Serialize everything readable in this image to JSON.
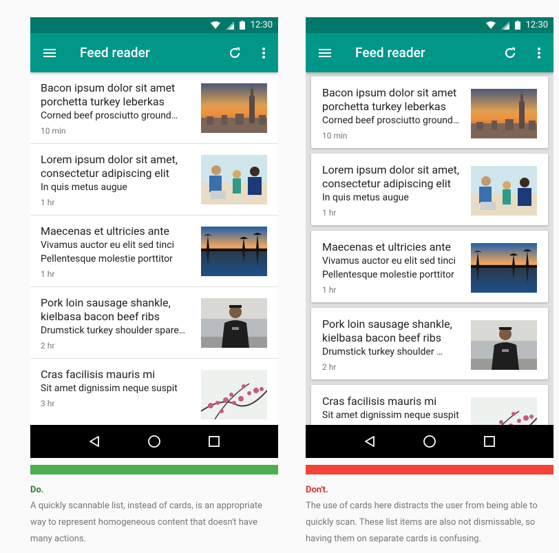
{
  "colors": {
    "status_bar": "#00796b",
    "app_bar": "#009688",
    "do": "#4caf50",
    "dont": "#f44336",
    "do_label": "#2e7d32",
    "dont_label": "#d32f2f"
  },
  "status": {
    "time": "12:30",
    "icons": [
      "wifi-icon",
      "signal-icon",
      "battery-icon"
    ]
  },
  "app": {
    "title": "Feed reader",
    "icons": {
      "menu": "menu-icon",
      "refresh": "refresh-icon",
      "more": "more-vert-icon"
    }
  },
  "left": {
    "items": [
      {
        "title": "Bacon ipsum dolor sit amet porchetta turkey leberkas",
        "lines": [
          "Corned beef prosciutto ground…"
        ],
        "time": "10 min",
        "image": "city-skyline"
      },
      {
        "title": "Lorem ipsum dolor sit amet, consectetur adipiscing elit",
        "lines": [
          "In quis metus augue"
        ],
        "time": "1 hr",
        "image": "family-beach"
      },
      {
        "title": "Maecenas et ultricies ante",
        "lines": [
          "Vivamus auctor eu elit sed tinci",
          "Pellentesque molestie porttitor"
        ],
        "time": "1 hr",
        "image": "palm-sunset"
      },
      {
        "title": "Pork loin sausage shankle, kielbasa bacon beef ribs",
        "lines": [
          "Drumstick turkey shoulder spare…"
        ],
        "time": "2 hr",
        "image": "man-portrait"
      },
      {
        "title": "Cras facilisis mauris mi",
        "lines": [
          "Sit amet dignissim neque suspit"
        ],
        "time": "3 hr",
        "image": "pink-blossoms"
      }
    ],
    "verdict": "Do.",
    "description": "A quickly scannable list, instead of cards, is an appropriate way to represent homogeneous content that doesn't have many actions."
  },
  "right": {
    "items": [
      {
        "title": "Bacon ipsum dolor sit amet porchetta turkey leberkas",
        "lines": [
          "Corned beef prosciutto ground…"
        ],
        "time": "10 min",
        "image": "city-skyline"
      },
      {
        "title": "Lorem ipsum dolor sit amet, consectetur adipiscing elit",
        "lines": [
          "In quis metus augue"
        ],
        "time": "1 hr",
        "image": "family-beach"
      },
      {
        "title": "Maecenas et ultricies ante",
        "lines": [
          "Vivamus auctor eu elit sed tinci",
          "Pellentesque molestie porttitor"
        ],
        "time": "1 hr",
        "image": "palm-sunset"
      },
      {
        "title": "Pork loin sausage shankle, kielbasa bacon beef ribs",
        "lines": [
          "Drumstick turkey shoulder …"
        ],
        "time": "2 hr",
        "image": "man-portrait"
      },
      {
        "title": "Cras facilisis mauris mi",
        "lines": [
          "Sit amet dignissim neque suspit"
        ],
        "time": "",
        "image": "pink-blossoms"
      }
    ],
    "verdict": "Don't.",
    "description": "The use of cards here distracts the user from being able to quickly scan. These list items are also not dismissable, so having them on separate cards is confusing."
  },
  "nav": {
    "icons": [
      "back-icon",
      "home-icon",
      "recents-icon"
    ]
  }
}
